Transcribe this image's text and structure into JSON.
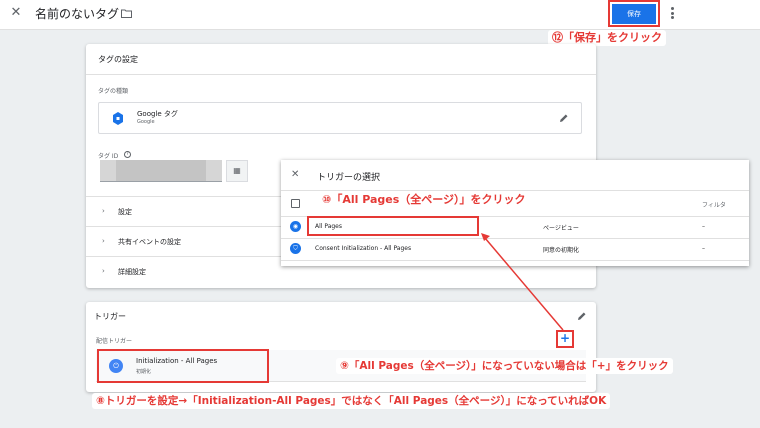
{
  "topbar": {
    "title": "名前のないタグ",
    "save_label": "保存",
    "close_glyph": "✕"
  },
  "callouts": {
    "save": "⑫「保存」をクリック",
    "all_pages": "⑩「All Pages（全ページ）」をクリック",
    "plus": "⑨「All Pages（全ページ）」になっていない場合は「+」をクリック",
    "bottom": "⑧トリガーを設定→「Initialization-All Pages」ではなく「All Pages（全ページ）」になっていればOK"
  },
  "tag_card": {
    "title": "タグの設定",
    "type_label": "タグの種類",
    "type_name": "Google タグ",
    "type_sub": "Google",
    "id_label": "タグ ID",
    "sections": [
      "設定",
      "共有イベントの設定",
      "詳細設定"
    ]
  },
  "trigger_card": {
    "title": "トリガー",
    "firing_label": "配信トリガー",
    "item_name": "Initialization - All Pages",
    "item_sub": "初期化"
  },
  "overlay": {
    "title": "トリガーの選択",
    "filter_col": "フィルタ",
    "rows": [
      {
        "name": "All Pages",
        "type": "ページビュー",
        "filter": "–"
      },
      {
        "name": "Consent Initialization - All Pages",
        "type": "同意の初期化",
        "filter": "–"
      }
    ]
  },
  "colors": {
    "accent": "#1a73e8",
    "callout_red": "#e53935"
  }
}
